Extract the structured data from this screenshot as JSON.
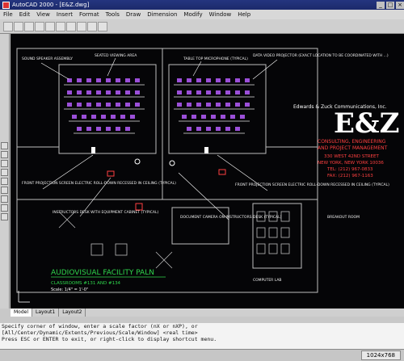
{
  "window": {
    "title": "AutoCAD 2000 - [E&Z.dwg]"
  },
  "menu": [
    "File",
    "Edit",
    "View",
    "Insert",
    "Format",
    "Tools",
    "Draw",
    "Dimension",
    "Modify",
    "Window",
    "Help"
  ],
  "drawing": {
    "labels": {
      "sound_speaker": "SOUND SPEAKER ASSEMBLY",
      "seated_viewing": "SEATED VIEWING AREA",
      "table_microphone": "TABLE TOP MICROPHONE (TYPICAL)",
      "data_projector": "DATA VIDEO PROJECTOR (EXACT LOCATION TO BE COORDINATED WITH ...)",
      "front_screen_left": "FRONT PROJECTION SCREEN ELECTRIC ROLL-DOWN RECESSED IN CEILING (TYPICAL)",
      "front_screen_right": "FRONT PROJECTION SCREEN ELECTRIC ROLL-DOWN RECESSED IN CEILING (TYPICAL)",
      "instructor_desk": "INSTRUCTORS DESK WITH EQUIPMENT CABINET (TYPICAL)",
      "document_camera": "DOCUMENT CAMERA ON INSTRUCTORS DESK (TYPICAL)",
      "breakout_room": "BREAKOUT ROOM",
      "computer_lab": "COMPUTER LAB"
    },
    "company": {
      "name": "Edwards & Zuck Communications, Inc.",
      "logo": "E&Z",
      "services": [
        "CONSULTING, ENGINEERING",
        "AND PROJECT MANAGEMENT"
      ],
      "address": [
        "330 WEST 42ND STREET",
        "NEW YORK, NEW YORK 10036"
      ],
      "phone": "TEL: (212) 967-0833",
      "fax": "FAX: (212) 967-1163"
    },
    "plan_title": "AUDIOVISUAL FACILITY PALN",
    "plan_subtitle": "CLASSROOMS #131 AND #134",
    "plan_scale": "Scale: 1/4\" = 1'-0\""
  },
  "tabs": [
    "Model",
    "Layout1",
    "Layout2"
  ],
  "command_lines": [
    "Specify corner of window, enter a scale factor (nX or nXP), or",
    "[All/Center/Dynamic/Extents/Previous/Scale/Window] <real time>",
    "Press ESC or ENTER to exit, or right-click to display shortcut menu."
  ],
  "status": {
    "coords": "1024x768"
  },
  "colors": {
    "seat": "#9b4fd9",
    "line": "#d7d7d7",
    "accent": "#ff4040",
    "title_green": "#2fd64c",
    "canvas": "#050507"
  }
}
